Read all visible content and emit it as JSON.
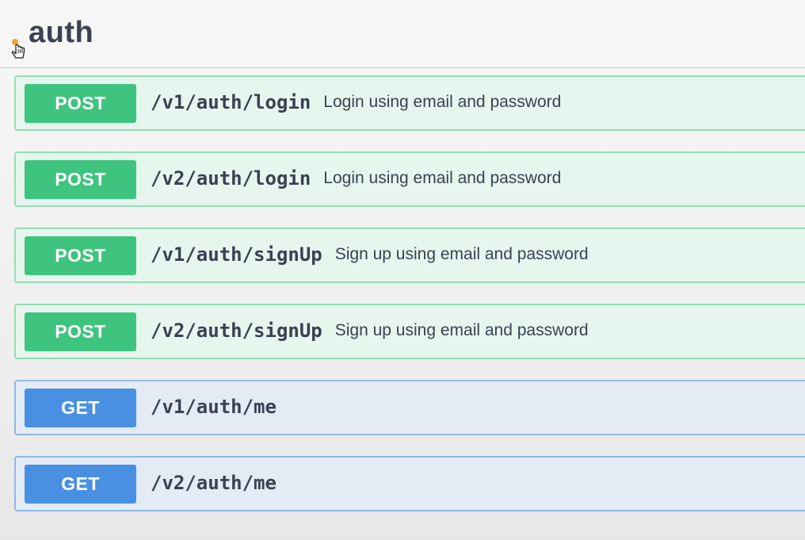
{
  "section": {
    "title": "auth"
  },
  "operations": [
    {
      "method": "POST",
      "path": "/v1/auth/login",
      "summary": "Login using email and password"
    },
    {
      "method": "POST",
      "path": "/v2/auth/login",
      "summary": "Login using email and password"
    },
    {
      "method": "POST",
      "path": "/v1/auth/signUp",
      "summary": "Sign up using email and password"
    },
    {
      "method": "POST",
      "path": "/v2/auth/signUp",
      "summary": "Sign up using email and password"
    },
    {
      "method": "GET",
      "path": "/v1/auth/me",
      "summary": ""
    },
    {
      "method": "GET",
      "path": "/v2/auth/me",
      "summary": ""
    }
  ],
  "colors": {
    "post_badge": "#3ec47e",
    "post_background": "#e6f5ee",
    "post_border": "#93dcb8",
    "get_badge": "#4a90e2",
    "get_background": "#e3ebf5",
    "get_border": "#8fb8e6",
    "text": "#3b4151"
  },
  "icons": {
    "cursor": "hand-pointer-icon"
  }
}
